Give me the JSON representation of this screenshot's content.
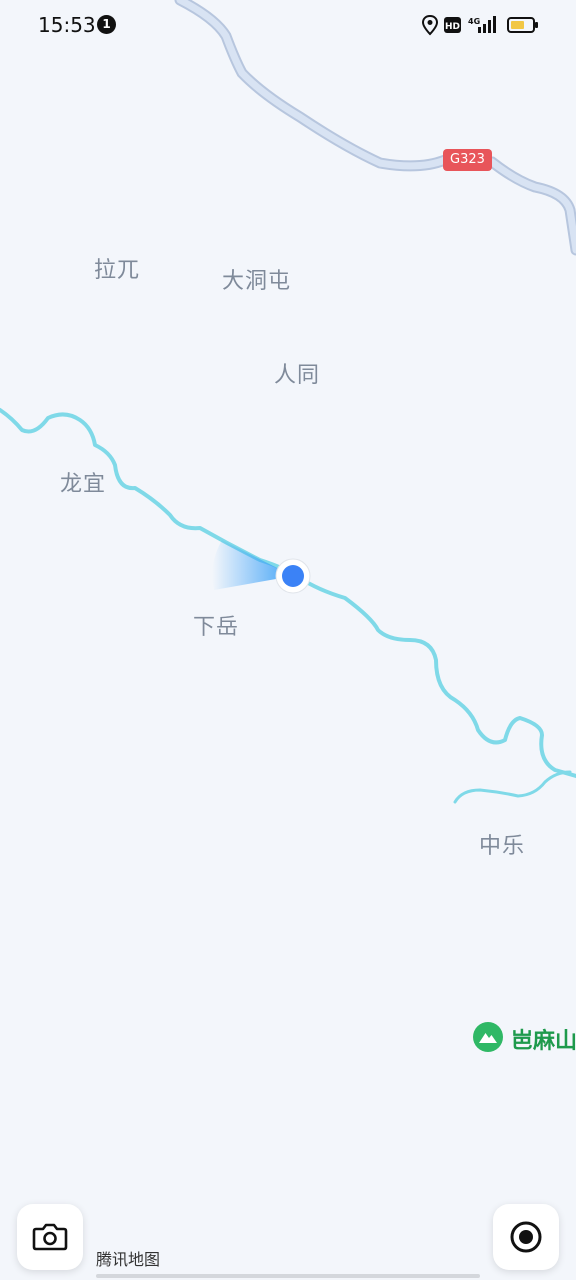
{
  "status_bar": {
    "time": "15:53",
    "notification_count": "1",
    "icons": [
      "location-icon",
      "hd-icon",
      "4g-signal-icon",
      "battery-icon"
    ],
    "hd_label": "HD",
    "network_label": "4G"
  },
  "map": {
    "road_shield": "G323",
    "places": {
      "lawu": "拉兀",
      "dadongtun": "大洞屯",
      "rentong": "人同",
      "longyi": "龙宜",
      "xiayue": "下岳",
      "zhongle": "中乐"
    },
    "poi": {
      "label": "岜麻山",
      "icon": "mountain-icon"
    },
    "attribution": "腾讯地图",
    "colors": {
      "background": "#f3f6fb",
      "road": "#c9d6ea",
      "river": "#7fd9e8",
      "road_shield": "#e8555a",
      "location_dot": "#3b82f6",
      "poi": "#2fb865"
    }
  },
  "controls": {
    "camera_button": "camera-icon",
    "locate_button": "locate-icon"
  }
}
